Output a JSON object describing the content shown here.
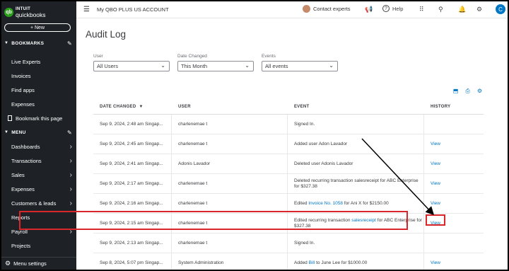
{
  "brand": {
    "logo_mark": "qb",
    "line1": "INTUIT",
    "line2": "quickbooks"
  },
  "sidebar": {
    "new_button": "+ New",
    "bookmarks_header": "BOOKMARKS",
    "bookmarks": [
      "Live Experts",
      "Invoices",
      "Find apps",
      "Expenses"
    ],
    "bookmark_this_page": "Bookmark this page",
    "menu_header": "MENU",
    "menu": [
      {
        "label": "Dashboards",
        "chevron": true
      },
      {
        "label": "Transactions",
        "chevron": true
      },
      {
        "label": "Sales",
        "chevron": true
      },
      {
        "label": "Expenses",
        "chevron": true
      },
      {
        "label": "Customers & leads",
        "chevron": true
      },
      {
        "label": "Reports",
        "chevron": false
      },
      {
        "label": "Payroll",
        "chevron": true
      },
      {
        "label": "Projects",
        "chevron": false
      }
    ],
    "footer": "Menu settings"
  },
  "topbar": {
    "account": "My QBO PLUS US ACCOUNT",
    "contact_experts": "Contact experts",
    "help": "Help",
    "user_initial": "C"
  },
  "page": {
    "title": "Audit Log",
    "filters": [
      {
        "label": "User",
        "value": "All Users"
      },
      {
        "label": "Date Changed",
        "value": "This Month"
      },
      {
        "label": "Events",
        "value": "All events"
      }
    ]
  },
  "table": {
    "headers": [
      "DATE CHANGED",
      "USER",
      "EVENT",
      "HISTORY"
    ],
    "sort_indicator": "▼",
    "rows": [
      {
        "date": "Sep 9, 2024, 2:48 am Singap...",
        "user": "charlenemae t",
        "event_pre": "Signed In.",
        "event_link": "",
        "event_post": "",
        "history": ""
      },
      {
        "date": "Sep 9, 2024, 2:45 am Singap...",
        "user": "charlenemae t",
        "event_pre": "Added user Adon Lavador",
        "event_link": "",
        "event_post": "",
        "history": "View"
      },
      {
        "date": "Sep 9, 2024, 2:41 am Singap...",
        "user": "Adonis Lavador",
        "event_pre": "Deleted user Adonis Lavador",
        "event_link": "",
        "event_post": "",
        "history": "View"
      },
      {
        "date": "Sep 9, 2024, 2:17 am Singap...",
        "user": "charlenemae t",
        "event_pre": "Deleted recurring transaction salesreceipt for ABC Enterprise for $327.38",
        "event_link": "",
        "event_post": "",
        "history": "View"
      },
      {
        "date": "Sep 9, 2024, 2:16 am Singap...",
        "user": "charlenemae t",
        "event_pre": "Edited ",
        "event_link": "Invoice No. 1058",
        "event_post": " for Ani X for $2150.00",
        "history": "View"
      },
      {
        "date": "Sep 9, 2024, 2:15 am Singap...",
        "user": "charlenemae t",
        "event_pre": "Edited recurring transaction ",
        "event_link": "salesreceipt",
        "event_post": " for ABC Enterprise for $327.38",
        "history": "View"
      },
      {
        "date": "Sep 9, 2024, 2:13 am Singap...",
        "user": "charlenemae t",
        "event_pre": "Signed In.",
        "event_link": "",
        "event_post": "",
        "history": ""
      },
      {
        "date": "Sep 8, 2024, 5:07 pm Singap...",
        "user": "System Administration",
        "event_pre": "Added ",
        "event_link": "Bill",
        "event_post": " to June Lee for $1000.00",
        "history": "View"
      }
    ]
  },
  "colors": {
    "sidebar_bg": "#1e2227",
    "link": "#0077c5",
    "highlight": "#d9262b",
    "brand_green": "#2ca01c"
  }
}
